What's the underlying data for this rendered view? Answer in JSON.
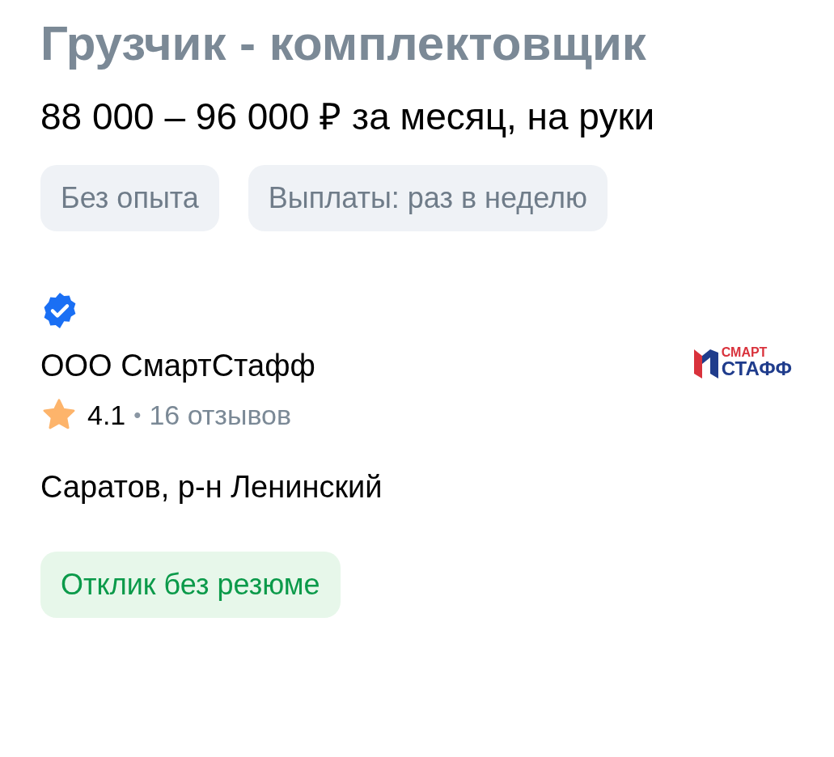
{
  "title": "Грузчик - комплектовщик",
  "salary": "88 000 – 96 000 ₽ за месяц, на руки",
  "tags": [
    "Без опыта",
    "Выплаты: раз в неделю"
  ],
  "company": {
    "verified": true,
    "name": "ООО СмартСтафф",
    "logo": {
      "top": "СМАРТ",
      "bottom": "СТАФФ"
    },
    "rating": "4.1",
    "separator": "•",
    "reviews": "16 отзывов"
  },
  "location": "Саратов, р-н Ленинский",
  "action": "Отклик без резюме"
}
